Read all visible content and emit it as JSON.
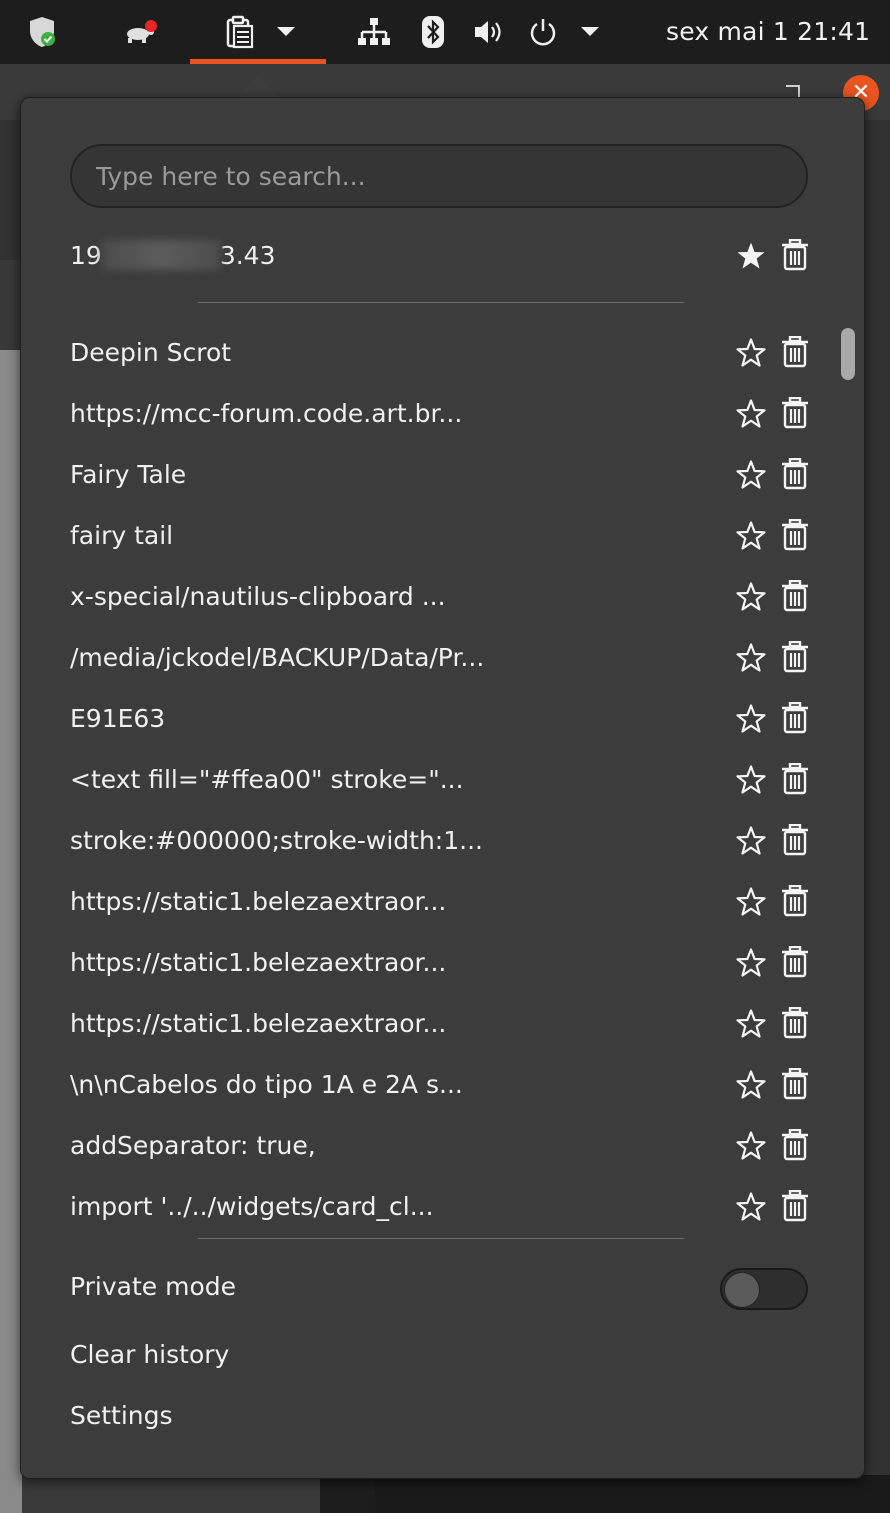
{
  "topbar": {
    "clock": "sex mai 1  21:41",
    "icons": [
      "shield-check-icon",
      "turtle-notification-icon",
      "clipboard-icon",
      "chevron-down-icon",
      "network-icon",
      "bluetooth-icon",
      "volume-icon",
      "power-icon",
      "chevron-down-icon"
    ]
  },
  "colors": {
    "accent": "#e95420",
    "popup_bg": "#3c3c3c",
    "panel_bg": "#1d1d1d"
  },
  "search": {
    "placeholder": "Type here to search..."
  },
  "pinned": {
    "prefix": "19",
    "suffix": "3.43",
    "favorite": true
  },
  "history": [
    {
      "text": "Deepin Scrot"
    },
    {
      "text": "https://mcc-forum.code.art.br..."
    },
    {
      "text": "Fairy Tale"
    },
    {
      "text": "fairy tail"
    },
    {
      "text": "x-special/nautilus-clipboard ..."
    },
    {
      "text": "/media/jckodel/BACKUP/Data/Pr..."
    },
    {
      "text": "E91E63"
    },
    {
      "text": "<text fill=\"#ffea00\" stroke=\"..."
    },
    {
      "text": "stroke:#000000;stroke-width:1..."
    },
    {
      "text": "https://static1.belezaextraor..."
    },
    {
      "text": "https://static1.belezaextraor..."
    },
    {
      "text": "https://static1.belezaextraor..."
    },
    {
      "text": "\\n\\nCabelos do tipo 1A e 2A s..."
    },
    {
      "text": "addSeparator: true,"
    },
    {
      "text": "import '../../widgets/card_cl..."
    }
  ],
  "menu": {
    "private_mode": "Private mode",
    "private_mode_on": false,
    "clear_history": "Clear history",
    "settings": "Settings"
  }
}
